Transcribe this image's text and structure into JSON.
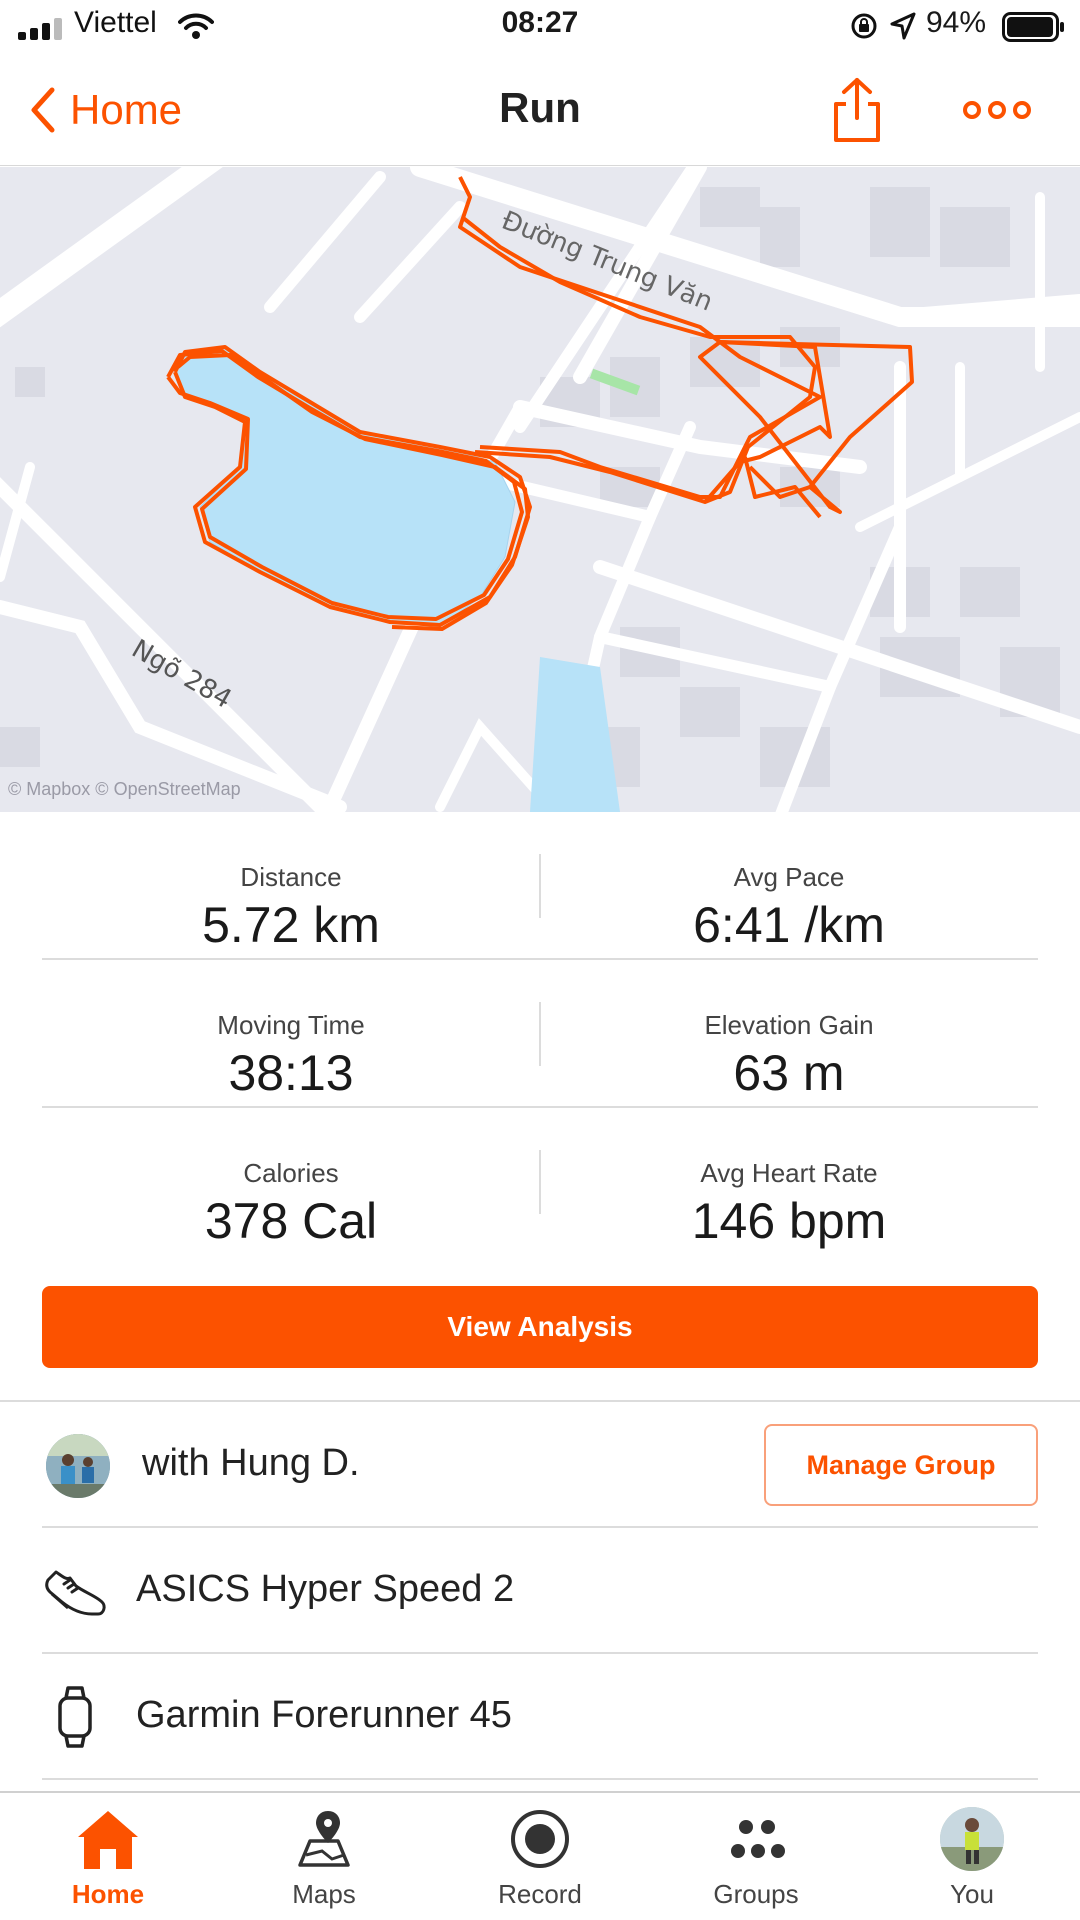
{
  "status_bar": {
    "carrier": "Viettel",
    "time": "08:27",
    "battery": "94%"
  },
  "nav": {
    "back_label": "Home",
    "title": "Run"
  },
  "map": {
    "street_1": "Đường Trung Văn",
    "street_2": "Ngõ 284",
    "attribution": "© Mapbox © OpenStreetMap"
  },
  "stats": [
    {
      "left": {
        "label": "Distance",
        "value": "5.72 km"
      },
      "right": {
        "label": "Avg Pace",
        "value": "6:41 /km"
      }
    },
    {
      "left": {
        "label": "Moving Time",
        "value": "38:13"
      },
      "right": {
        "label": "Elevation Gain",
        "value": "63 m"
      }
    },
    {
      "left": {
        "label": "Calories",
        "value": "378 Cal"
      },
      "right": {
        "label": "Avg Heart Rate",
        "value": "146 bpm"
      }
    }
  ],
  "cta": {
    "view_analysis": "View Analysis"
  },
  "group": {
    "text": "with Hung D.",
    "manage_label": "Manage Group"
  },
  "gear": {
    "shoe": "ASICS Hyper Speed 2",
    "device": "Garmin Forerunner 45"
  },
  "tabs": [
    {
      "label": "Home"
    },
    {
      "label": "Maps"
    },
    {
      "label": "Record"
    },
    {
      "label": "Groups"
    },
    {
      "label": "You"
    }
  ],
  "colors": {
    "accent": "#fc5200",
    "water": "#b7e2f8",
    "map_bg": "#e7e8ef"
  }
}
